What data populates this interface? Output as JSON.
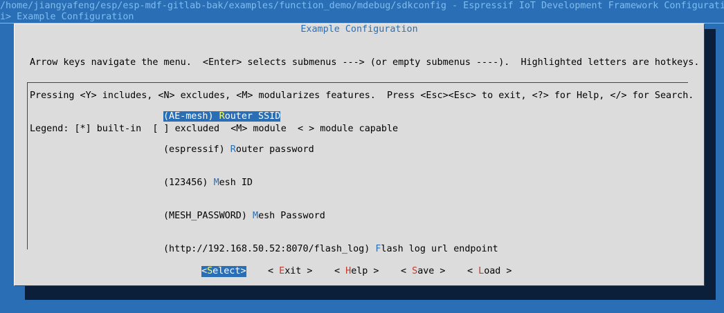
{
  "window": {
    "title": "/home/jiangyafeng/esp/esp-mdf-gitlab-bak/examples/function_demo/mdebug/sdkconfig - Espressif IoT Development Framework Configurati",
    "breadcrumb": "i> Example Configuration"
  },
  "dialog": {
    "title": "Example Configuration",
    "help_lines": [
      "Arrow keys navigate the menu.  <Enter> selects submenus ---> (or empty submenus ----).  Highlighted letters are hotkeys.",
      "Pressing <Y> includes, <N> excludes, <M> modularizes features.  Press <Esc><Esc> to exit, <?> for Help, </> for Search.",
      "Legend: [*] built-in  [ ] excluded  <M> module  < > module capable"
    ]
  },
  "menu": {
    "items": [
      {
        "value": "(AE-mesh)",
        "hotkey": "R",
        "label_rest": "outer SSID",
        "selected": true
      },
      {
        "value": "(espressif)",
        "hotkey": "R",
        "label_rest": "outer password",
        "selected": false
      },
      {
        "value": "(123456)",
        "hotkey": "M",
        "label_rest": "esh ID",
        "selected": false
      },
      {
        "value": "(MESH_PASSWORD)",
        "hotkey": "M",
        "label_rest": "esh Password",
        "selected": false
      },
      {
        "value": "(http://192.168.50.52:8070/flash_log)",
        "hotkey": "F",
        "label_rest": "lash log url endpoint",
        "selected": false
      }
    ]
  },
  "buttons": {
    "select": {
      "open": "<",
      "hot": "S",
      "rest": "elect",
      "close": ">"
    },
    "exit": {
      "open": "< ",
      "hot": "E",
      "rest": "xit",
      "close": " >"
    },
    "help": {
      "open": "< ",
      "hot": "H",
      "rest": "elp",
      "close": " >"
    },
    "save": {
      "open": "< ",
      "hot": "S",
      "rest": "ave",
      "close": " >"
    },
    "load": {
      "open": "< ",
      "hot": "L",
      "rest": "oad",
      "close": " >"
    }
  },
  "colors": {
    "background": "#2a6fb5",
    "dialog": "#dcdcdc",
    "hotkey": "#2a6fb5",
    "selected_hotkey": "#ffff5a",
    "button_hotkey": "#c0392b"
  }
}
